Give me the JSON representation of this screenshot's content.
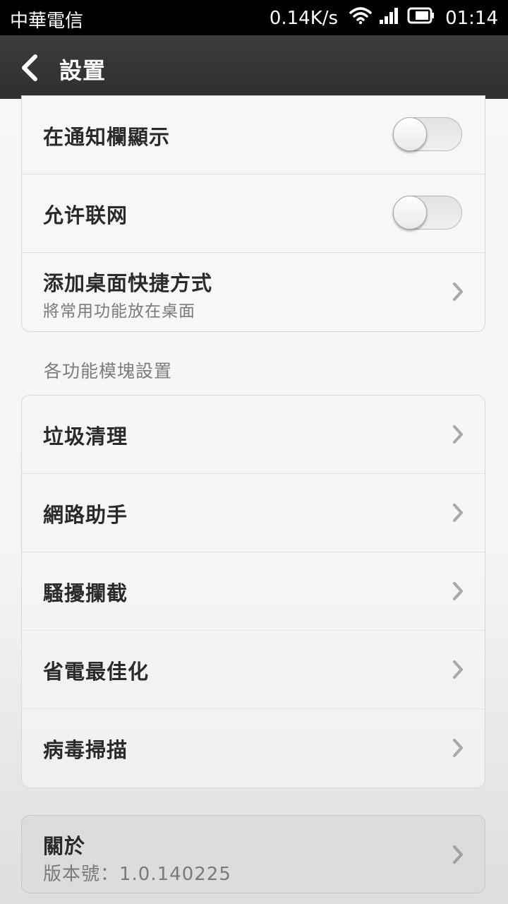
{
  "status_bar": {
    "carrier": "中華電信",
    "speed": "0.14K/s",
    "time": "01:14",
    "icons": [
      "wifi-icon",
      "signal-icon",
      "battery-icon"
    ]
  },
  "header": {
    "back_icon": "chevron-left-icon",
    "title": "設置"
  },
  "general": {
    "items": [
      {
        "title": "在通知欄顯示",
        "control": "toggle",
        "on": false
      },
      {
        "title": "允许联网",
        "control": "toggle",
        "on": false
      },
      {
        "title": "添加桌面快捷方式",
        "subtitle": "將常用功能放在桌面",
        "control": "chevron"
      }
    ]
  },
  "modules": {
    "label": "各功能模塊設置",
    "items": [
      {
        "title": "垃圾清理"
      },
      {
        "title": "網路助手"
      },
      {
        "title": "騷擾攔截"
      },
      {
        "title": "省電最佳化"
      },
      {
        "title": "病毒掃描"
      }
    ]
  },
  "about": {
    "title": "關於",
    "subtitle": "版本號：1.0.140225"
  },
  "colors": {
    "action_bar": "#333333",
    "card_bg": "#f7f7f7",
    "primary_text": "#2a2a2a",
    "secondary_text": "#7a7a7a"
  }
}
